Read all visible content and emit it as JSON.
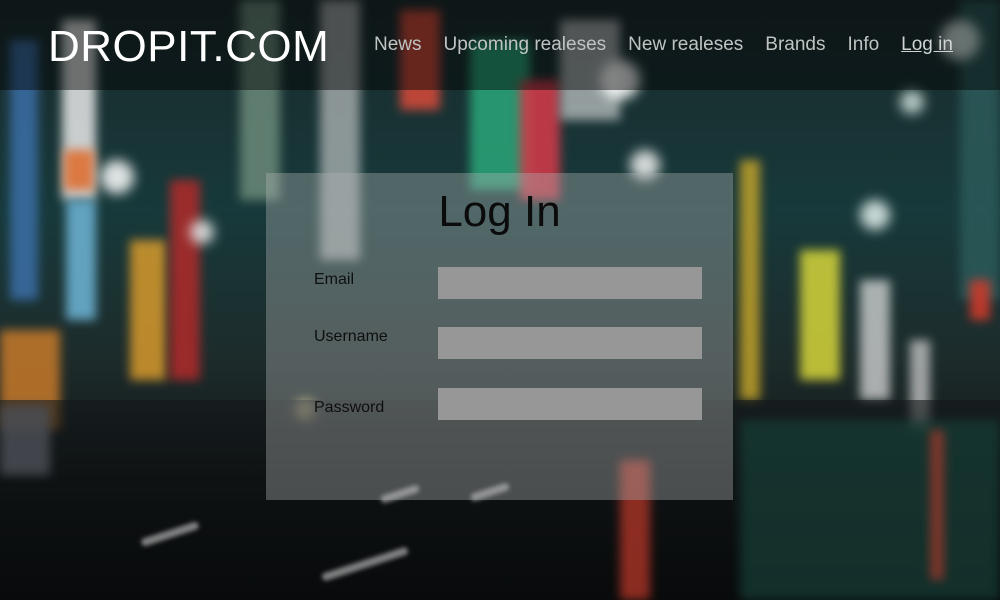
{
  "site": {
    "logo": "DROPIT.COM"
  },
  "nav": {
    "items": [
      {
        "label": "News"
      },
      {
        "label": "Upcoming realeses"
      },
      {
        "label": "New realeses"
      },
      {
        "label": "Brands"
      },
      {
        "label": "Info"
      },
      {
        "label": "Log in"
      }
    ]
  },
  "login": {
    "title": "Log In",
    "email_label": "Email",
    "email_value": "",
    "username_label": "Username",
    "username_value": "",
    "password_label": "Password",
    "password_value": ""
  },
  "colors": {
    "header_bg": "#000000",
    "input_bg": "#979797",
    "panel_bg": "#afb4b4"
  }
}
